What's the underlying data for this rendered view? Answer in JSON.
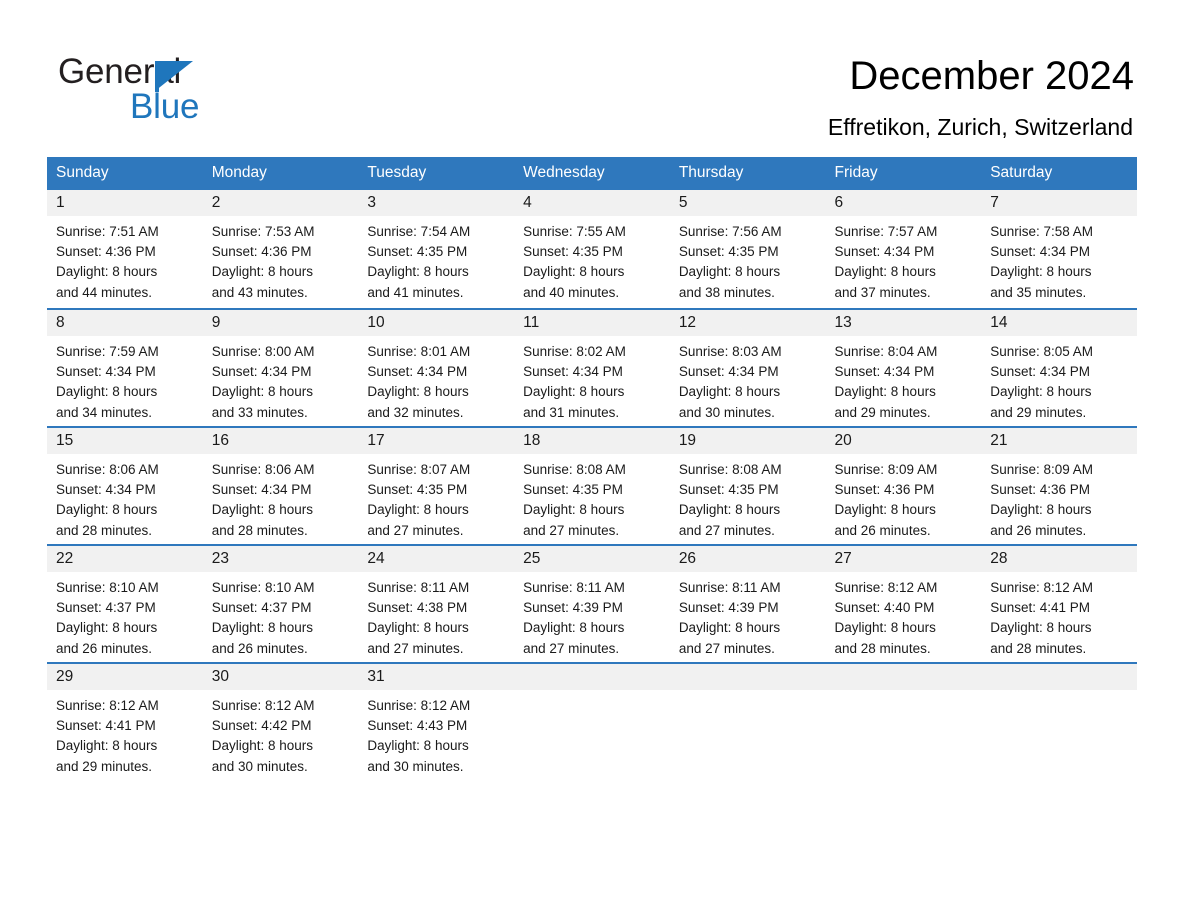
{
  "brand": {
    "name_part1": "General",
    "name_part2": "Blue",
    "triangle_color": "#1f76bc",
    "text_color": "#231f20"
  },
  "header": {
    "title": "December 2024",
    "location": "Effretikon, Zurich, Switzerland"
  },
  "colors": {
    "header_blue": "#2f78bd",
    "day_band_gray": "#f1f1f1",
    "text": "#1a1a1a",
    "background": "#ffffff"
  },
  "weekdays": [
    "Sunday",
    "Monday",
    "Tuesday",
    "Wednesday",
    "Thursday",
    "Friday",
    "Saturday"
  ],
  "weeks": [
    [
      {
        "day": "1",
        "sunrise": "Sunrise: 7:51 AM",
        "sunset": "Sunset: 4:36 PM",
        "daylight1": "Daylight: 8 hours",
        "daylight2": "and 44 minutes."
      },
      {
        "day": "2",
        "sunrise": "Sunrise: 7:53 AM",
        "sunset": "Sunset: 4:36 PM",
        "daylight1": "Daylight: 8 hours",
        "daylight2": "and 43 minutes."
      },
      {
        "day": "3",
        "sunrise": "Sunrise: 7:54 AM",
        "sunset": "Sunset: 4:35 PM",
        "daylight1": "Daylight: 8 hours",
        "daylight2": "and 41 minutes."
      },
      {
        "day": "4",
        "sunrise": "Sunrise: 7:55 AM",
        "sunset": "Sunset: 4:35 PM",
        "daylight1": "Daylight: 8 hours",
        "daylight2": "and 40 minutes."
      },
      {
        "day": "5",
        "sunrise": "Sunrise: 7:56 AM",
        "sunset": "Sunset: 4:35 PM",
        "daylight1": "Daylight: 8 hours",
        "daylight2": "and 38 minutes."
      },
      {
        "day": "6",
        "sunrise": "Sunrise: 7:57 AM",
        "sunset": "Sunset: 4:34 PM",
        "daylight1": "Daylight: 8 hours",
        "daylight2": "and 37 minutes."
      },
      {
        "day": "7",
        "sunrise": "Sunrise: 7:58 AM",
        "sunset": "Sunset: 4:34 PM",
        "daylight1": "Daylight: 8 hours",
        "daylight2": "and 35 minutes."
      }
    ],
    [
      {
        "day": "8",
        "sunrise": "Sunrise: 7:59 AM",
        "sunset": "Sunset: 4:34 PM",
        "daylight1": "Daylight: 8 hours",
        "daylight2": "and 34 minutes."
      },
      {
        "day": "9",
        "sunrise": "Sunrise: 8:00 AM",
        "sunset": "Sunset: 4:34 PM",
        "daylight1": "Daylight: 8 hours",
        "daylight2": "and 33 minutes."
      },
      {
        "day": "10",
        "sunrise": "Sunrise: 8:01 AM",
        "sunset": "Sunset: 4:34 PM",
        "daylight1": "Daylight: 8 hours",
        "daylight2": "and 32 minutes."
      },
      {
        "day": "11",
        "sunrise": "Sunrise: 8:02 AM",
        "sunset": "Sunset: 4:34 PM",
        "daylight1": "Daylight: 8 hours",
        "daylight2": "and 31 minutes."
      },
      {
        "day": "12",
        "sunrise": "Sunrise: 8:03 AM",
        "sunset": "Sunset: 4:34 PM",
        "daylight1": "Daylight: 8 hours",
        "daylight2": "and 30 minutes."
      },
      {
        "day": "13",
        "sunrise": "Sunrise: 8:04 AM",
        "sunset": "Sunset: 4:34 PM",
        "daylight1": "Daylight: 8 hours",
        "daylight2": "and 29 minutes."
      },
      {
        "day": "14",
        "sunrise": "Sunrise: 8:05 AM",
        "sunset": "Sunset: 4:34 PM",
        "daylight1": "Daylight: 8 hours",
        "daylight2": "and 29 minutes."
      }
    ],
    [
      {
        "day": "15",
        "sunrise": "Sunrise: 8:06 AM",
        "sunset": "Sunset: 4:34 PM",
        "daylight1": "Daylight: 8 hours",
        "daylight2": "and 28 minutes."
      },
      {
        "day": "16",
        "sunrise": "Sunrise: 8:06 AM",
        "sunset": "Sunset: 4:34 PM",
        "daylight1": "Daylight: 8 hours",
        "daylight2": "and 28 minutes."
      },
      {
        "day": "17",
        "sunrise": "Sunrise: 8:07 AM",
        "sunset": "Sunset: 4:35 PM",
        "daylight1": "Daylight: 8 hours",
        "daylight2": "and 27 minutes."
      },
      {
        "day": "18",
        "sunrise": "Sunrise: 8:08 AM",
        "sunset": "Sunset: 4:35 PM",
        "daylight1": "Daylight: 8 hours",
        "daylight2": "and 27 minutes."
      },
      {
        "day": "19",
        "sunrise": "Sunrise: 8:08 AM",
        "sunset": "Sunset: 4:35 PM",
        "daylight1": "Daylight: 8 hours",
        "daylight2": "and 27 minutes."
      },
      {
        "day": "20",
        "sunrise": "Sunrise: 8:09 AM",
        "sunset": "Sunset: 4:36 PM",
        "daylight1": "Daylight: 8 hours",
        "daylight2": "and 26 minutes."
      },
      {
        "day": "21",
        "sunrise": "Sunrise: 8:09 AM",
        "sunset": "Sunset: 4:36 PM",
        "daylight1": "Daylight: 8 hours",
        "daylight2": "and 26 minutes."
      }
    ],
    [
      {
        "day": "22",
        "sunrise": "Sunrise: 8:10 AM",
        "sunset": "Sunset: 4:37 PM",
        "daylight1": "Daylight: 8 hours",
        "daylight2": "and 26 minutes."
      },
      {
        "day": "23",
        "sunrise": "Sunrise: 8:10 AM",
        "sunset": "Sunset: 4:37 PM",
        "daylight1": "Daylight: 8 hours",
        "daylight2": "and 26 minutes."
      },
      {
        "day": "24",
        "sunrise": "Sunrise: 8:11 AM",
        "sunset": "Sunset: 4:38 PM",
        "daylight1": "Daylight: 8 hours",
        "daylight2": "and 27 minutes."
      },
      {
        "day": "25",
        "sunrise": "Sunrise: 8:11 AM",
        "sunset": "Sunset: 4:39 PM",
        "daylight1": "Daylight: 8 hours",
        "daylight2": "and 27 minutes."
      },
      {
        "day": "26",
        "sunrise": "Sunrise: 8:11 AM",
        "sunset": "Sunset: 4:39 PM",
        "daylight1": "Daylight: 8 hours",
        "daylight2": "and 27 minutes."
      },
      {
        "day": "27",
        "sunrise": "Sunrise: 8:12 AM",
        "sunset": "Sunset: 4:40 PM",
        "daylight1": "Daylight: 8 hours",
        "daylight2": "and 28 minutes."
      },
      {
        "day": "28",
        "sunrise": "Sunrise: 8:12 AM",
        "sunset": "Sunset: 4:41 PM",
        "daylight1": "Daylight: 8 hours",
        "daylight2": "and 28 minutes."
      }
    ],
    [
      {
        "day": "29",
        "sunrise": "Sunrise: 8:12 AM",
        "sunset": "Sunset: 4:41 PM",
        "daylight1": "Daylight: 8 hours",
        "daylight2": "and 29 minutes."
      },
      {
        "day": "30",
        "sunrise": "Sunrise: 8:12 AM",
        "sunset": "Sunset: 4:42 PM",
        "daylight1": "Daylight: 8 hours",
        "daylight2": "and 30 minutes."
      },
      {
        "day": "31",
        "sunrise": "Sunrise: 8:12 AM",
        "sunset": "Sunset: 4:43 PM",
        "daylight1": "Daylight: 8 hours",
        "daylight2": "and 30 minutes."
      },
      {
        "day": "",
        "sunrise": "",
        "sunset": "",
        "daylight1": "",
        "daylight2": ""
      },
      {
        "day": "",
        "sunrise": "",
        "sunset": "",
        "daylight1": "",
        "daylight2": ""
      },
      {
        "day": "",
        "sunrise": "",
        "sunset": "",
        "daylight1": "",
        "daylight2": ""
      },
      {
        "day": "",
        "sunrise": "",
        "sunset": "",
        "daylight1": "",
        "daylight2": ""
      }
    ]
  ]
}
